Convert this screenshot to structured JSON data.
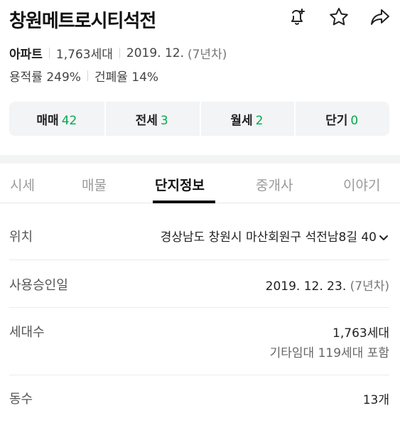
{
  "header": {
    "title": "창원메트로시티석전",
    "icons": [
      "bell-plus-icon",
      "star-icon",
      "share-icon"
    ]
  },
  "meta": {
    "type": "아파트",
    "households": "1,763세대",
    "approval": "2019. 12.",
    "years": "(7년차)",
    "floor_area_ratio": "용적률 249%",
    "building_coverage": "건폐율 14%"
  },
  "counts": [
    {
      "label": "매매",
      "value": "42"
    },
    {
      "label": "전세",
      "value": "3"
    },
    {
      "label": "월세",
      "value": "2"
    },
    {
      "label": "단기",
      "value": "0"
    }
  ],
  "tabs": [
    {
      "label": "시세"
    },
    {
      "label": "매물"
    },
    {
      "label": "단지정보",
      "active": true
    },
    {
      "label": "중개사"
    },
    {
      "label": "이야기"
    }
  ],
  "info": {
    "location": {
      "label": "위치",
      "value": "경상남도 창원시 마산회원구 석전남8길 40"
    },
    "approval_date": {
      "label": "사용승인일",
      "value": "2019. 12. 23.",
      "years": "(7년차)"
    },
    "households": {
      "label": "세대수",
      "value": "1,763세대",
      "sub": "기타임대 119세대 포함"
    },
    "buildings": {
      "label": "동수",
      "value": "13개"
    }
  },
  "colors": {
    "accent": "#03a94d",
    "panel": "#f3f4f6"
  }
}
